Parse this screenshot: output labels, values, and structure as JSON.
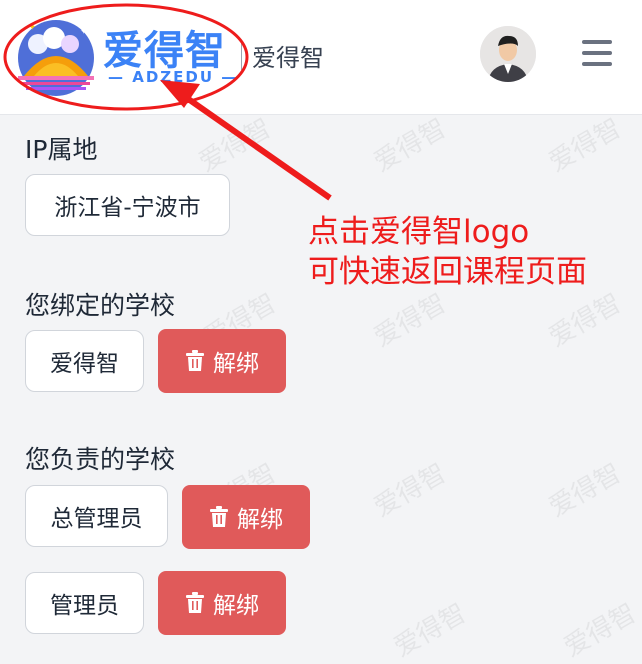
{
  "header": {
    "logo_text": "爱得智",
    "logo_subtext": "ADZEDU",
    "brand_name": "爱得智",
    "avatar_icon": "user-avatar",
    "menu_icon": "hamburger-menu-icon"
  },
  "ip": {
    "title": "IP属地",
    "value": "浙江省-宁波市"
  },
  "bound_school": {
    "title": "您绑定的学校",
    "school": "爱得智",
    "unbind_label": "解绑"
  },
  "responsible_school": {
    "title": "您负责的学校",
    "roles": [
      {
        "role": "总管理员",
        "unbind_label": "解绑"
      },
      {
        "role": "管理员",
        "unbind_label": "解绑"
      }
    ]
  },
  "annotation": {
    "line1": "点击爱得智logo",
    "line2": "可快速返回课程页面"
  },
  "watermark_text": "爱得智",
  "colors": {
    "accent": "#3b82f6",
    "danger": "#e05a5a",
    "annotation": "#ee1c1c"
  }
}
